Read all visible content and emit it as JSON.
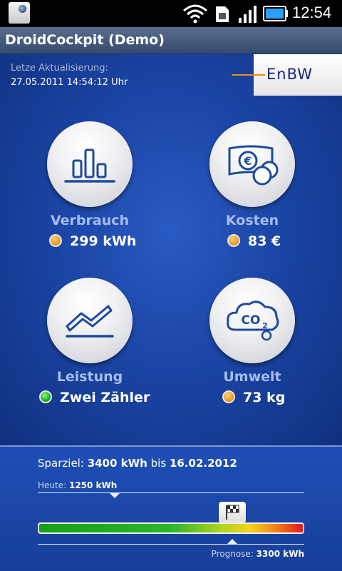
{
  "status_bar": {
    "time": "12:54",
    "icons": [
      "notification-icon",
      "wifi-icon",
      "sim-icon",
      "signal-icon",
      "battery-icon"
    ]
  },
  "app": {
    "title": "DroidCockpit (Demo)"
  },
  "header": {
    "update_label": "Letze Aktualisierung:",
    "update_value": "27.05.2011 14:54:12 Uhr",
    "logo_text": "EnBW"
  },
  "tiles": [
    {
      "label": "Verbrauch",
      "value": "299 kWh",
      "status": "orange",
      "icon": "bar-chart-icon"
    },
    {
      "label": "Kosten",
      "value": "83 €",
      "status": "orange",
      "icon": "euro-money-icon"
    },
    {
      "label": "Leistung",
      "value": "Zwei Zähler",
      "status": "green",
      "icon": "line-chart-icon"
    },
    {
      "label": "Umwelt",
      "value": "73 kg",
      "status": "orange",
      "icon": "co2-cloud-icon"
    }
  ],
  "goal": {
    "prefix": "Sparziel:",
    "amount": "3400 kWh",
    "middle": "bis",
    "date": "16.02.2012",
    "today_label": "Heute:",
    "today_value": "1250 kWh",
    "forecast_label": "Prognose:",
    "forecast_value": "3300 kWh",
    "today_fraction": 0.29,
    "forecast_fraction": 0.73
  },
  "colors": {
    "status_orange": "#e8901a",
    "status_green": "#10a010",
    "tile_label": "#a8bcf0",
    "logo_accent": "#f08a1c",
    "logo_text": "#1a237e"
  }
}
